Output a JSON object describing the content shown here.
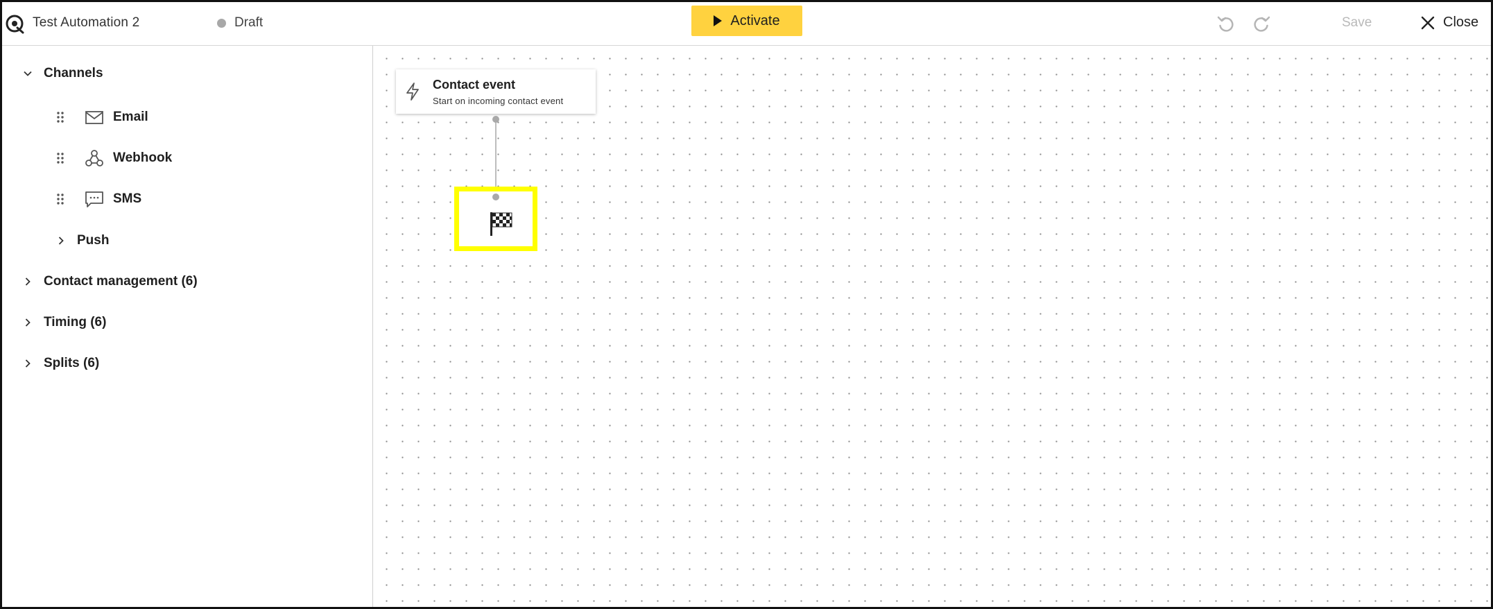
{
  "header": {
    "title": "Test Automation 2",
    "status": "Draft",
    "activate_label": "Activate",
    "save_label": "Save",
    "close_label": "Close"
  },
  "sidebar": {
    "channels": {
      "label": "Channels",
      "items": [
        {
          "label": "Email",
          "icon": "envelope-icon"
        },
        {
          "label": "Webhook",
          "icon": "webhook-icon"
        },
        {
          "label": "SMS",
          "icon": "sms-icon"
        }
      ],
      "push_label": "Push"
    },
    "groups": [
      {
        "label": "Contact management (6)"
      },
      {
        "label": "Timing (6)"
      },
      {
        "label": "Splits (6)"
      }
    ]
  },
  "canvas": {
    "trigger_node": {
      "title": "Contact event",
      "subtitle": "Start on incoming contact event",
      "icon": "lightning-bolt-icon"
    },
    "end_node": {
      "icon": "checkered-flag-icon"
    }
  },
  "colors": {
    "accent": "#ffd23f",
    "highlight": "#ffff00",
    "save_disabled": "#b9b9b9"
  }
}
